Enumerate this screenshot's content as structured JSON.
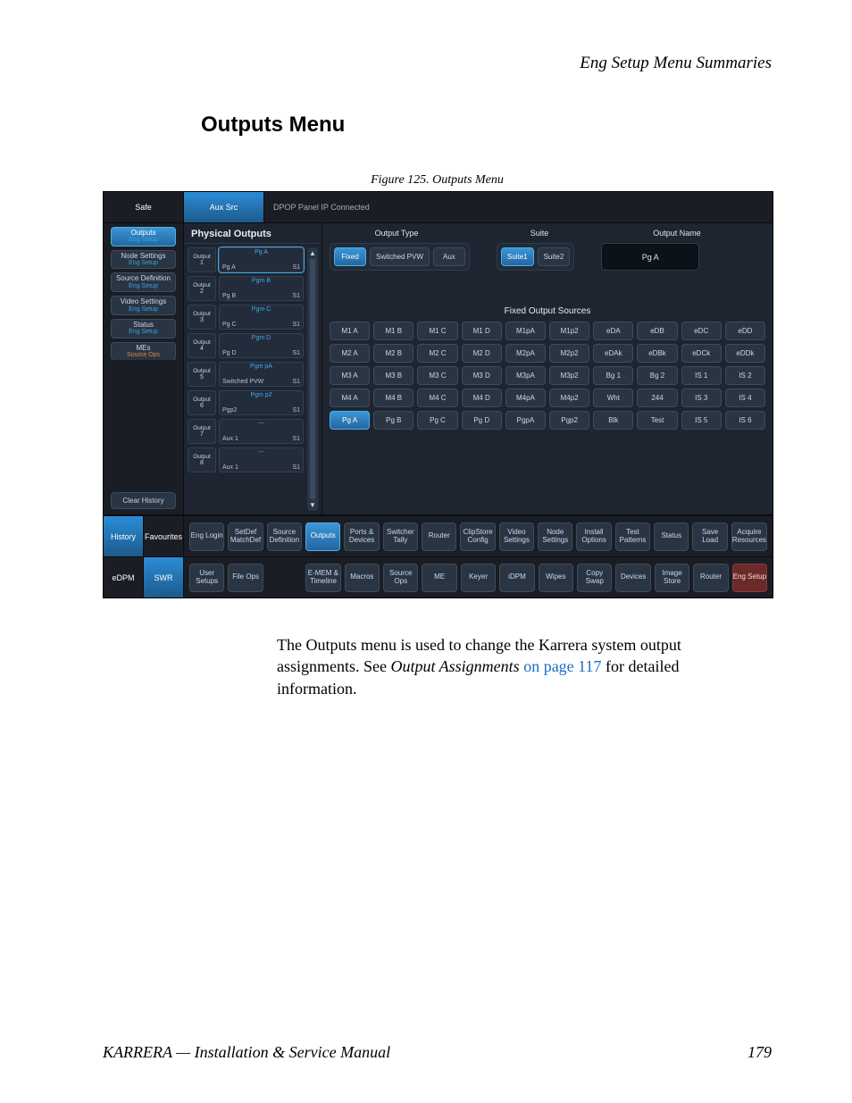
{
  "header": "Eng Setup Menu Summaries",
  "heading": "Outputs Menu",
  "figure_caption": "Figure 125.  Outputs Menu",
  "ui": {
    "topTabs": {
      "safe": "Safe",
      "aux": "Aux Src"
    },
    "dpop": "DPOP Panel IP Connected",
    "navStack": [
      {
        "label": "Outputs",
        "sub": "Eng Setup",
        "cls": "top"
      },
      {
        "label": "Node Settings",
        "sub": "Eng Setup"
      },
      {
        "label": "Source Definition",
        "sub": "Eng Setup"
      },
      {
        "label": "Video Settings",
        "sub": "Eng Setup"
      },
      {
        "label": "Status",
        "sub": "Eng Setup"
      },
      {
        "label": "MEs",
        "sub": "Source Ops",
        "cls": "so"
      }
    ],
    "clearHistory": "Clear History",
    "physTitle": "Physical Outputs",
    "physList": [
      {
        "n": "1",
        "name": "Pg A",
        "sub": "Pg A",
        "suite": "S1",
        "sel": true
      },
      {
        "n": "2",
        "name": "Pgm B",
        "sub": "Pg B",
        "suite": "S1"
      },
      {
        "n": "3",
        "name": "Pgm C",
        "sub": "Pg C",
        "suite": "S1"
      },
      {
        "n": "4",
        "name": "Pgm D",
        "sub": "Pg D",
        "suite": "S1"
      },
      {
        "n": "5",
        "name": "Pgm pA",
        "sub": "Switched PVW",
        "suite": "S1"
      },
      {
        "n": "6",
        "name": "Pgm p2",
        "sub": "Pgp2",
        "suite": "S1"
      },
      {
        "n": "7",
        "name": "---",
        "sub": "Aux 1",
        "suite": "S1"
      },
      {
        "n": "8",
        "name": "---",
        "sub": "Aux 1",
        "suite": "S1"
      }
    ],
    "hdrs": {
      "ot": "Output Type",
      "st": "Suite",
      "on": "Output Name"
    },
    "outputType": [
      {
        "label": "Fixed",
        "sel": true
      },
      {
        "label": "Switched PVW"
      },
      {
        "label": "Aux"
      }
    ],
    "suite": [
      {
        "label": "Suite1",
        "sel": true
      },
      {
        "label": "Suite2"
      }
    ],
    "outputName": "Pg A",
    "fosTitle": "Fixed Output Sources",
    "grid": [
      [
        "M1 A",
        "M1 B",
        "M1 C",
        "M1 D",
        "M1pA",
        "M1p2",
        "eDA",
        "eDB",
        "eDC",
        "eDD"
      ],
      [
        "M2 A",
        "M2 B",
        "M2 C",
        "M2 D",
        "M2pA",
        "M2p2",
        "eDAk",
        "eDBk",
        "eDCk",
        "eDDk"
      ],
      [
        "M3 A",
        "M3 B",
        "M3 C",
        "M3 D",
        "M3pA",
        "M3p2",
        "Bg 1",
        "Bg 2",
        "IS 1",
        "IS 2"
      ],
      [
        "M4 A",
        "M4 B",
        "M4 C",
        "M4 D",
        "M4pA",
        "M4p2",
        "Wht",
        "244",
        "IS 3",
        "IS 4"
      ],
      [
        "Pg A",
        "Pg B",
        "Pg C",
        "Pg D",
        "PgpA",
        "Pgp2",
        "Blk",
        "Test",
        "IS 5",
        "IS 6"
      ]
    ],
    "gridSel": "Pg A",
    "bar1Left": {
      "history": "History",
      "fav": "Favourites"
    },
    "bar1": [
      "Eng Login",
      "SetDef MatchDef",
      "Source Definition",
      "Outputs",
      "Ports & Devices",
      "Switcher Tally",
      "Router",
      "ClipStore Config",
      "Video Settings",
      "Node Settings",
      "Install Options",
      "Test Patterns",
      "Status",
      "Save Load",
      "Acquire Resources"
    ],
    "bar1Sel": "Outputs",
    "bar2Left": {
      "edpm": "eDPM",
      "swr": "SWR"
    },
    "bar2": [
      "User Setups",
      "File Ops",
      "",
      "E-MEM & Timeline",
      "Macros",
      "Source Ops",
      "ME",
      "Keyer",
      "iDPM",
      "Wipes",
      "Copy Swap",
      "Devices",
      "Image Store",
      "Router",
      "Eng Setup"
    ]
  },
  "paragraph": {
    "lead": "The Outputs menu is used to change the Karrera system output assignments. See ",
    "em": "Output Assignments",
    "link": " on page 117",
    "tail": " for detailed information."
  },
  "footer": {
    "left": "KARRERA  —  Installation & Service Manual",
    "page": "179"
  }
}
